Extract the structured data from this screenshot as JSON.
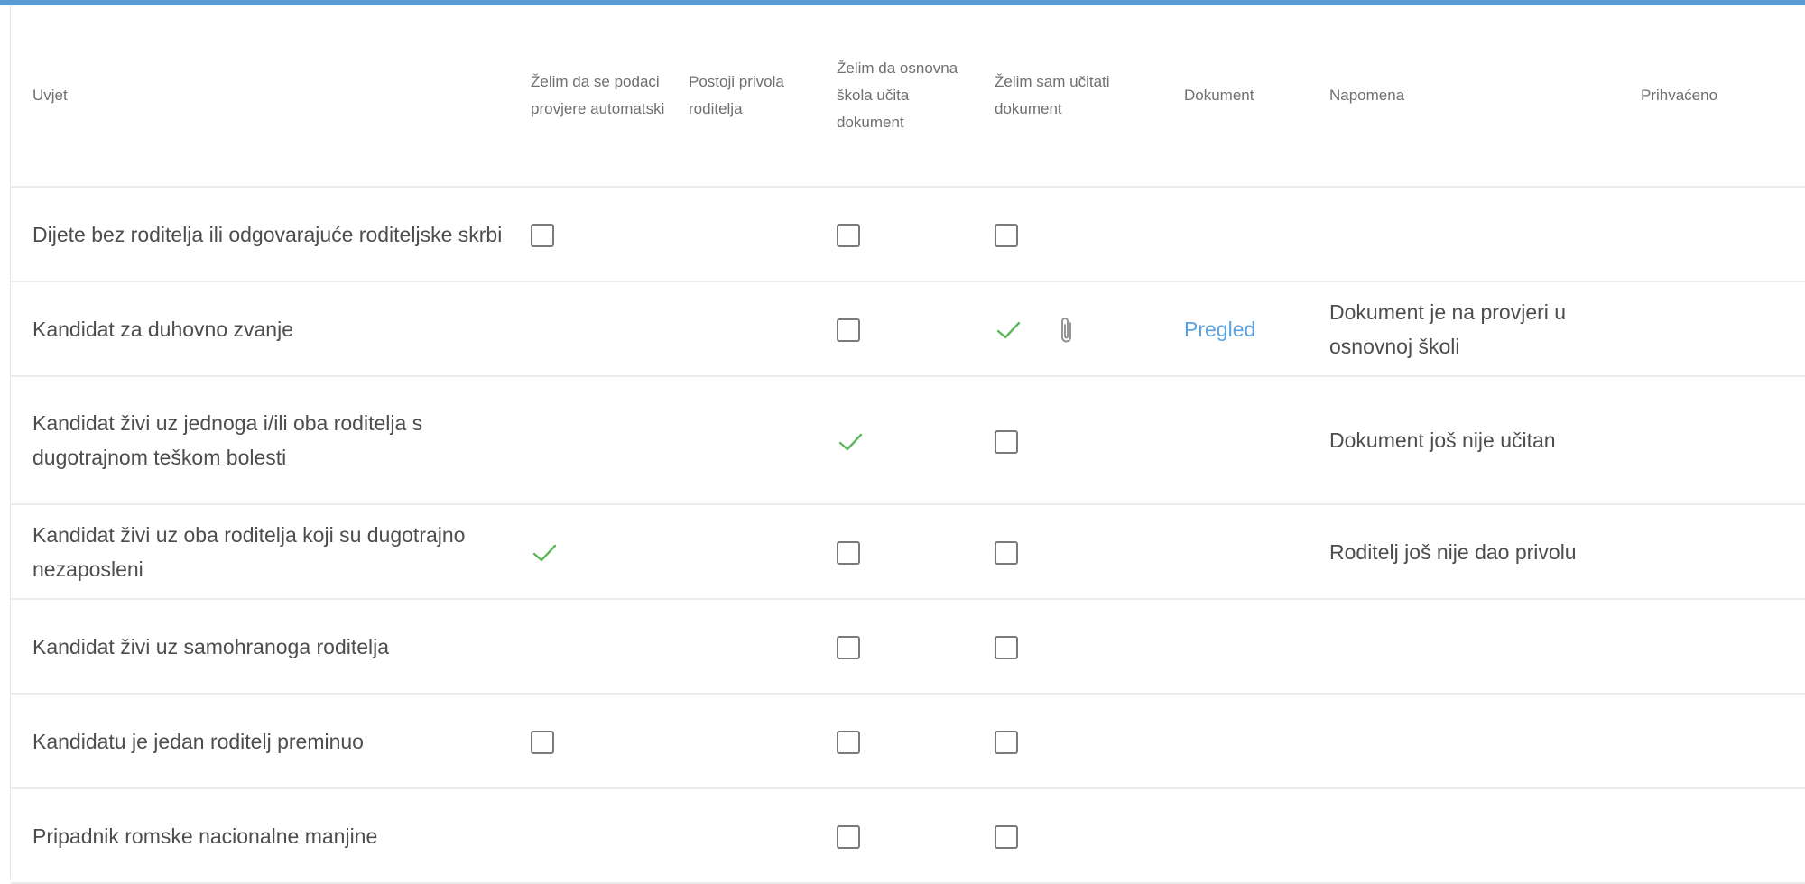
{
  "colors": {
    "accent_bar": "#5b9bd5",
    "check": "#5cb85c",
    "link": "#5aa3e0"
  },
  "table": {
    "headers": {
      "uvjet": "Uvjet",
      "auto": "Želim da se podaci provjere automatski",
      "privola": "Postoji privola roditelja",
      "skola": "Želim da osnovna škola učita dokument",
      "sam": "Želim sam učitati dokument",
      "dokument": "Dokument",
      "napomena": "Napomena",
      "prihvaceno": "Prihvaćeno"
    },
    "rows": [
      {
        "uvjet": "Dijete bez roditelja ili odgovarajuće roditeljske skrbi",
        "auto": "checkbox",
        "skola": "checkbox",
        "sam": "checkbox",
        "dokument": "",
        "napomena": ""
      },
      {
        "uvjet": "Kandidat za duhovno zvanje",
        "auto": "",
        "skola": "checkbox",
        "sam": "check+attachment",
        "dokument": "Pregled",
        "napomena": "Dokument je na provjeri u osnovnoj školi"
      },
      {
        "uvjet": "Kandidat živi uz jednoga i/ili oba roditelja s dugotrajnom teškom bolesti",
        "auto": "",
        "skola": "check",
        "sam": "checkbox",
        "dokument": "",
        "napomena": "Dokument još nije učitan"
      },
      {
        "uvjet": "Kandidat živi uz oba roditelja koji su dugotrajno nezaposleni",
        "auto": "check",
        "skola": "checkbox",
        "sam": "checkbox",
        "dokument": "",
        "napomena": "Roditelj još nije dao privolu"
      },
      {
        "uvjet": "Kandidat živi uz samohranoga roditelja",
        "auto": "",
        "skola": "checkbox",
        "sam": "checkbox",
        "dokument": "",
        "napomena": ""
      },
      {
        "uvjet": "Kandidatu je jedan roditelj preminuo",
        "auto": "checkbox",
        "skola": "checkbox",
        "sam": "checkbox",
        "dokument": "",
        "napomena": ""
      },
      {
        "uvjet": "Pripadnik romske nacionalne manjine",
        "auto": "",
        "skola": "checkbox",
        "sam": "checkbox",
        "dokument": "",
        "napomena": ""
      }
    ]
  }
}
